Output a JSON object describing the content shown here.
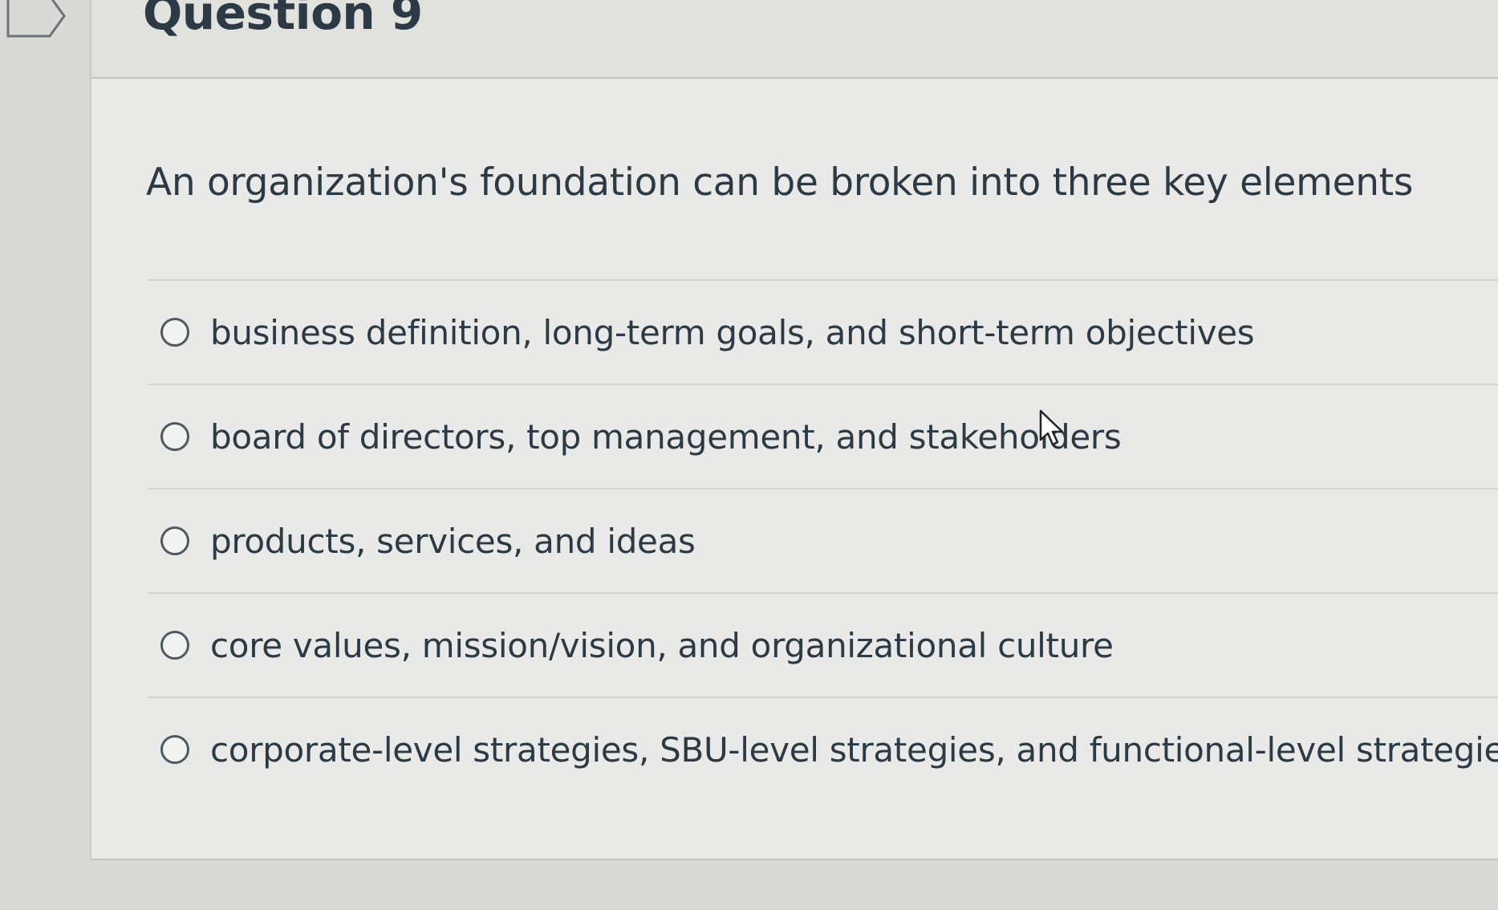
{
  "question": {
    "title": "Question 9",
    "prompt": "An organization's foundation can be broken into three key elements",
    "options": [
      {
        "label": "business definition, long-term goals, and short-term objectives"
      },
      {
        "label": "board of directors, top management, and stakeholders"
      },
      {
        "label": "products, services, and ideas"
      },
      {
        "label": "core values, mission/vision, and organizational culture"
      },
      {
        "label": "corporate-level strategies, SBU-level strategies, and functional-level strategies"
      }
    ]
  },
  "icons": {
    "flag": "bookmark-flag-icon",
    "cursor": "mouse-pointer-icon"
  },
  "colors": {
    "text": "#2b3a44",
    "background": "#e9e9e7"
  }
}
